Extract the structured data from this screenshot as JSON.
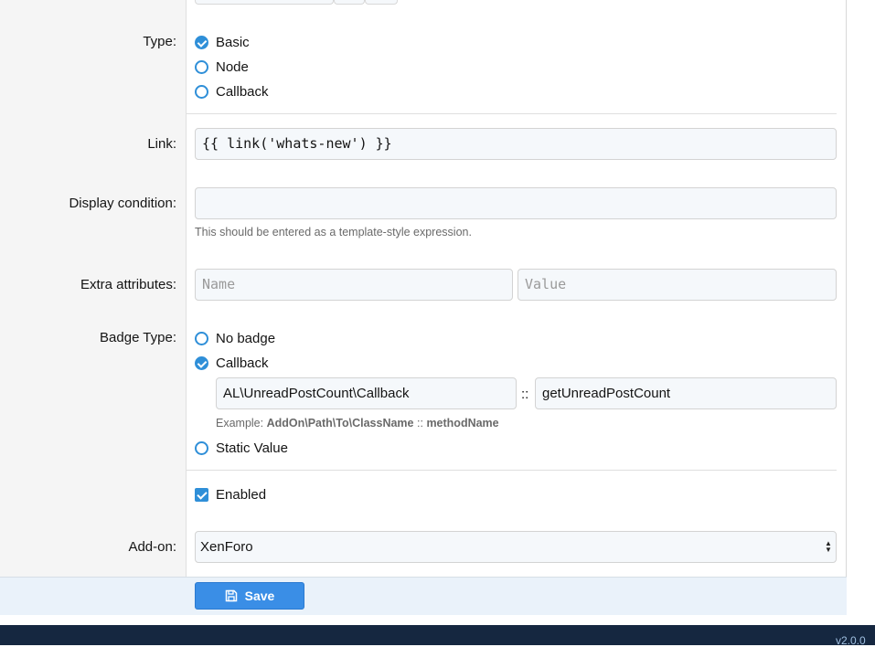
{
  "type_field": {
    "label": "Type:",
    "options": [
      {
        "label": "Basic",
        "selected": true
      },
      {
        "label": "Node",
        "selected": false
      },
      {
        "label": "Callback",
        "selected": false
      }
    ]
  },
  "link_field": {
    "label": "Link:",
    "value": "{{ link('whats-new') }}"
  },
  "display_condition": {
    "label": "Display condition:",
    "value": "",
    "hint": "This should be entered as a template-style expression."
  },
  "extra_attributes": {
    "label": "Extra attributes:",
    "name_placeholder": "Name",
    "value_placeholder": "Value"
  },
  "badge_type": {
    "label": "Badge Type:",
    "options": [
      {
        "label": "No badge",
        "selected": false
      },
      {
        "label": "Callback",
        "selected": true
      },
      {
        "label": "Static Value",
        "selected": false
      }
    ],
    "callback_class": "AL\\UnreadPostCount\\Callback",
    "separator": "::",
    "callback_method": "getUnreadPostCount",
    "example_prefix": "Example:",
    "example_class": "AddOn\\Path\\To\\ClassName",
    "example_sep": "::",
    "example_method": "methodName"
  },
  "enabled": {
    "label": "Enabled",
    "checked": true
  },
  "addon_field": {
    "label": "Add-on:",
    "selected": "XenForo"
  },
  "save_button": {
    "label": "Save"
  },
  "footer": {
    "version": "v2.0.0"
  },
  "colors": {
    "accent": "#2f8fd8",
    "button": "#3a8ee6",
    "footer": "#152740"
  }
}
